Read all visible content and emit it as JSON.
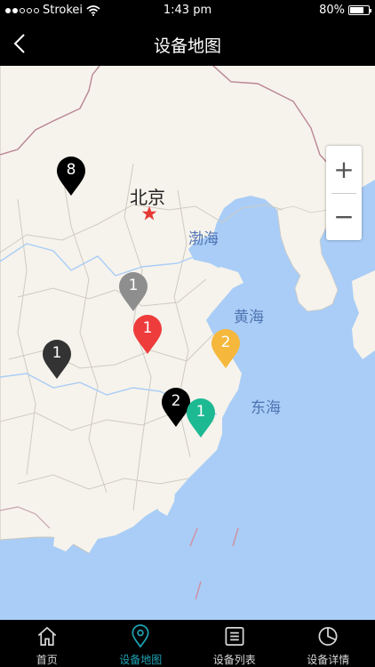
{
  "status": {
    "carrier": "Strokei",
    "time": "1:43 pm",
    "battery": "80%",
    "battery_level": 0.8
  },
  "nav": {
    "title": "设备地图"
  },
  "map": {
    "zoom_in": "+",
    "zoom_out": "−",
    "labels": {
      "beijing": "北京",
      "bohai": "渤海",
      "huanghai": "黄海",
      "donghai": "东海"
    },
    "markers": [
      {
        "count": "8",
        "color": "#000000"
      },
      {
        "count": "1",
        "color": "#8e8e8e"
      },
      {
        "count": "1",
        "color": "#ee3c3c"
      },
      {
        "count": "2",
        "color": "#f5b83d"
      },
      {
        "count": "1",
        "color": "#333333"
      },
      {
        "count": "2",
        "color": "#000000"
      },
      {
        "count": "1",
        "color": "#1db992"
      }
    ]
  },
  "tabs": [
    {
      "label": "首页",
      "icon": "home-icon"
    },
    {
      "label": "设备地图",
      "icon": "location-pin-icon"
    },
    {
      "label": "设备列表",
      "icon": "list-icon"
    },
    {
      "label": "设备详情",
      "icon": "pie-chart-icon"
    }
  ],
  "colors": {
    "accent": "#1fa3b4",
    "land": "#f6f3ec",
    "sea": "#a9cdf6",
    "bar": "#000000"
  }
}
